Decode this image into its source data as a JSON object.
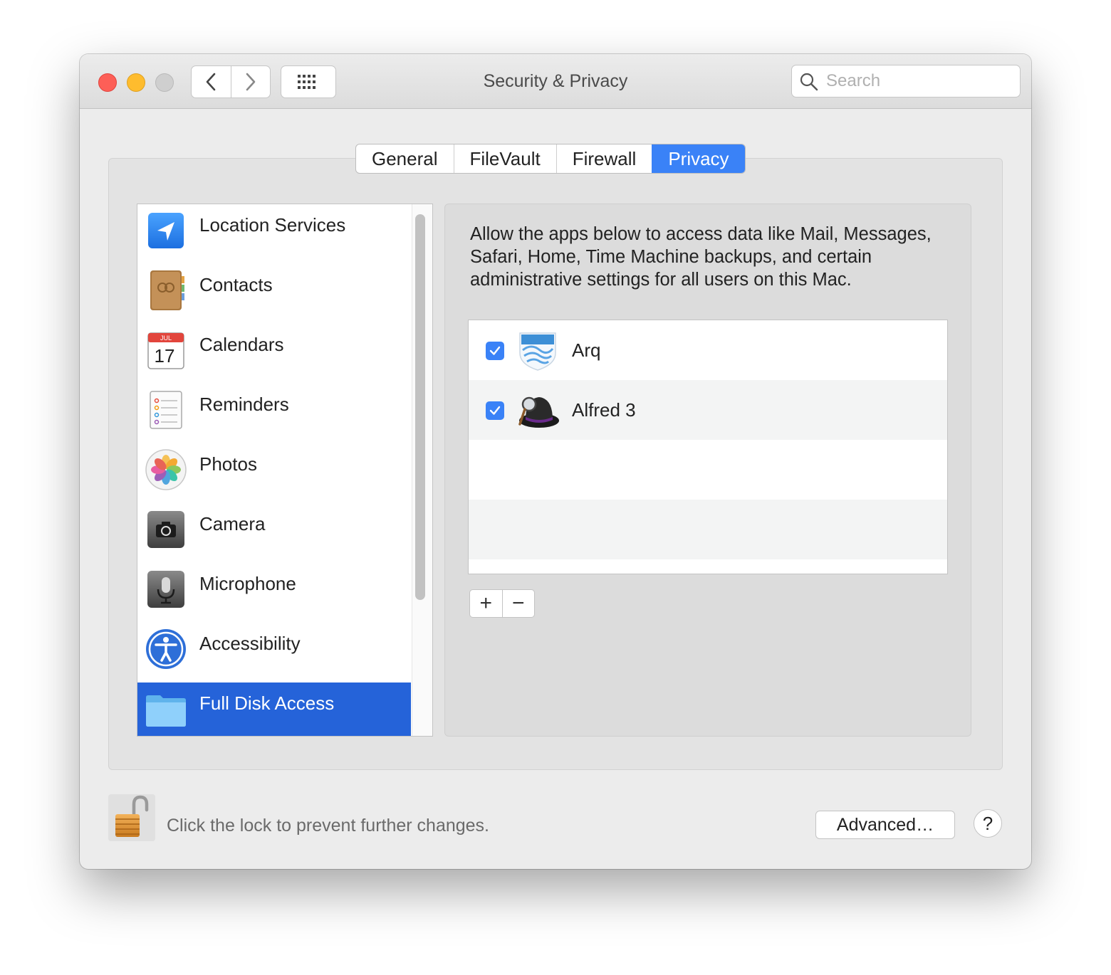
{
  "window": {
    "title": "Security & Privacy"
  },
  "search": {
    "placeholder": "Search"
  },
  "tabs": [
    {
      "label": "General"
    },
    {
      "label": "FileVault"
    },
    {
      "label": "Firewall"
    },
    {
      "label": "Privacy",
      "active": true
    }
  ],
  "sidebar": {
    "items": [
      {
        "label": "Location Services",
        "icon": "location-arrow-icon"
      },
      {
        "label": "Contacts",
        "icon": "contacts-book-icon"
      },
      {
        "label": "Calendars",
        "icon": "calendar-icon",
        "calendar_month": "JUL",
        "calendar_day": "17"
      },
      {
        "label": "Reminders",
        "icon": "reminders-icon"
      },
      {
        "label": "Photos",
        "icon": "photos-flower-icon"
      },
      {
        "label": "Camera",
        "icon": "camera-icon"
      },
      {
        "label": "Microphone",
        "icon": "microphone-icon"
      },
      {
        "label": "Accessibility",
        "icon": "accessibility-icon"
      },
      {
        "label": "Full Disk Access",
        "icon": "folder-icon",
        "selected": true
      }
    ]
  },
  "detail": {
    "description": "Allow the apps below to access data like Mail, Messages, Safari, Home, Time Machine backups, and certain administrative settings for all users on this Mac.",
    "apps": [
      {
        "name": "Arq",
        "checked": true,
        "icon": "arq-icon"
      },
      {
        "name": "Alfred 3",
        "checked": true,
        "icon": "alfred-hat-icon"
      }
    ],
    "add_label": "+",
    "remove_label": "−"
  },
  "footer": {
    "lock_text": "Click the lock to prevent further changes.",
    "advanced_label": "Advanced…",
    "help_label": "?"
  },
  "colors": {
    "accent": "#3a82f7",
    "selection": "#2563d9",
    "close": "#fd5f57",
    "minimize": "#febc2e"
  }
}
